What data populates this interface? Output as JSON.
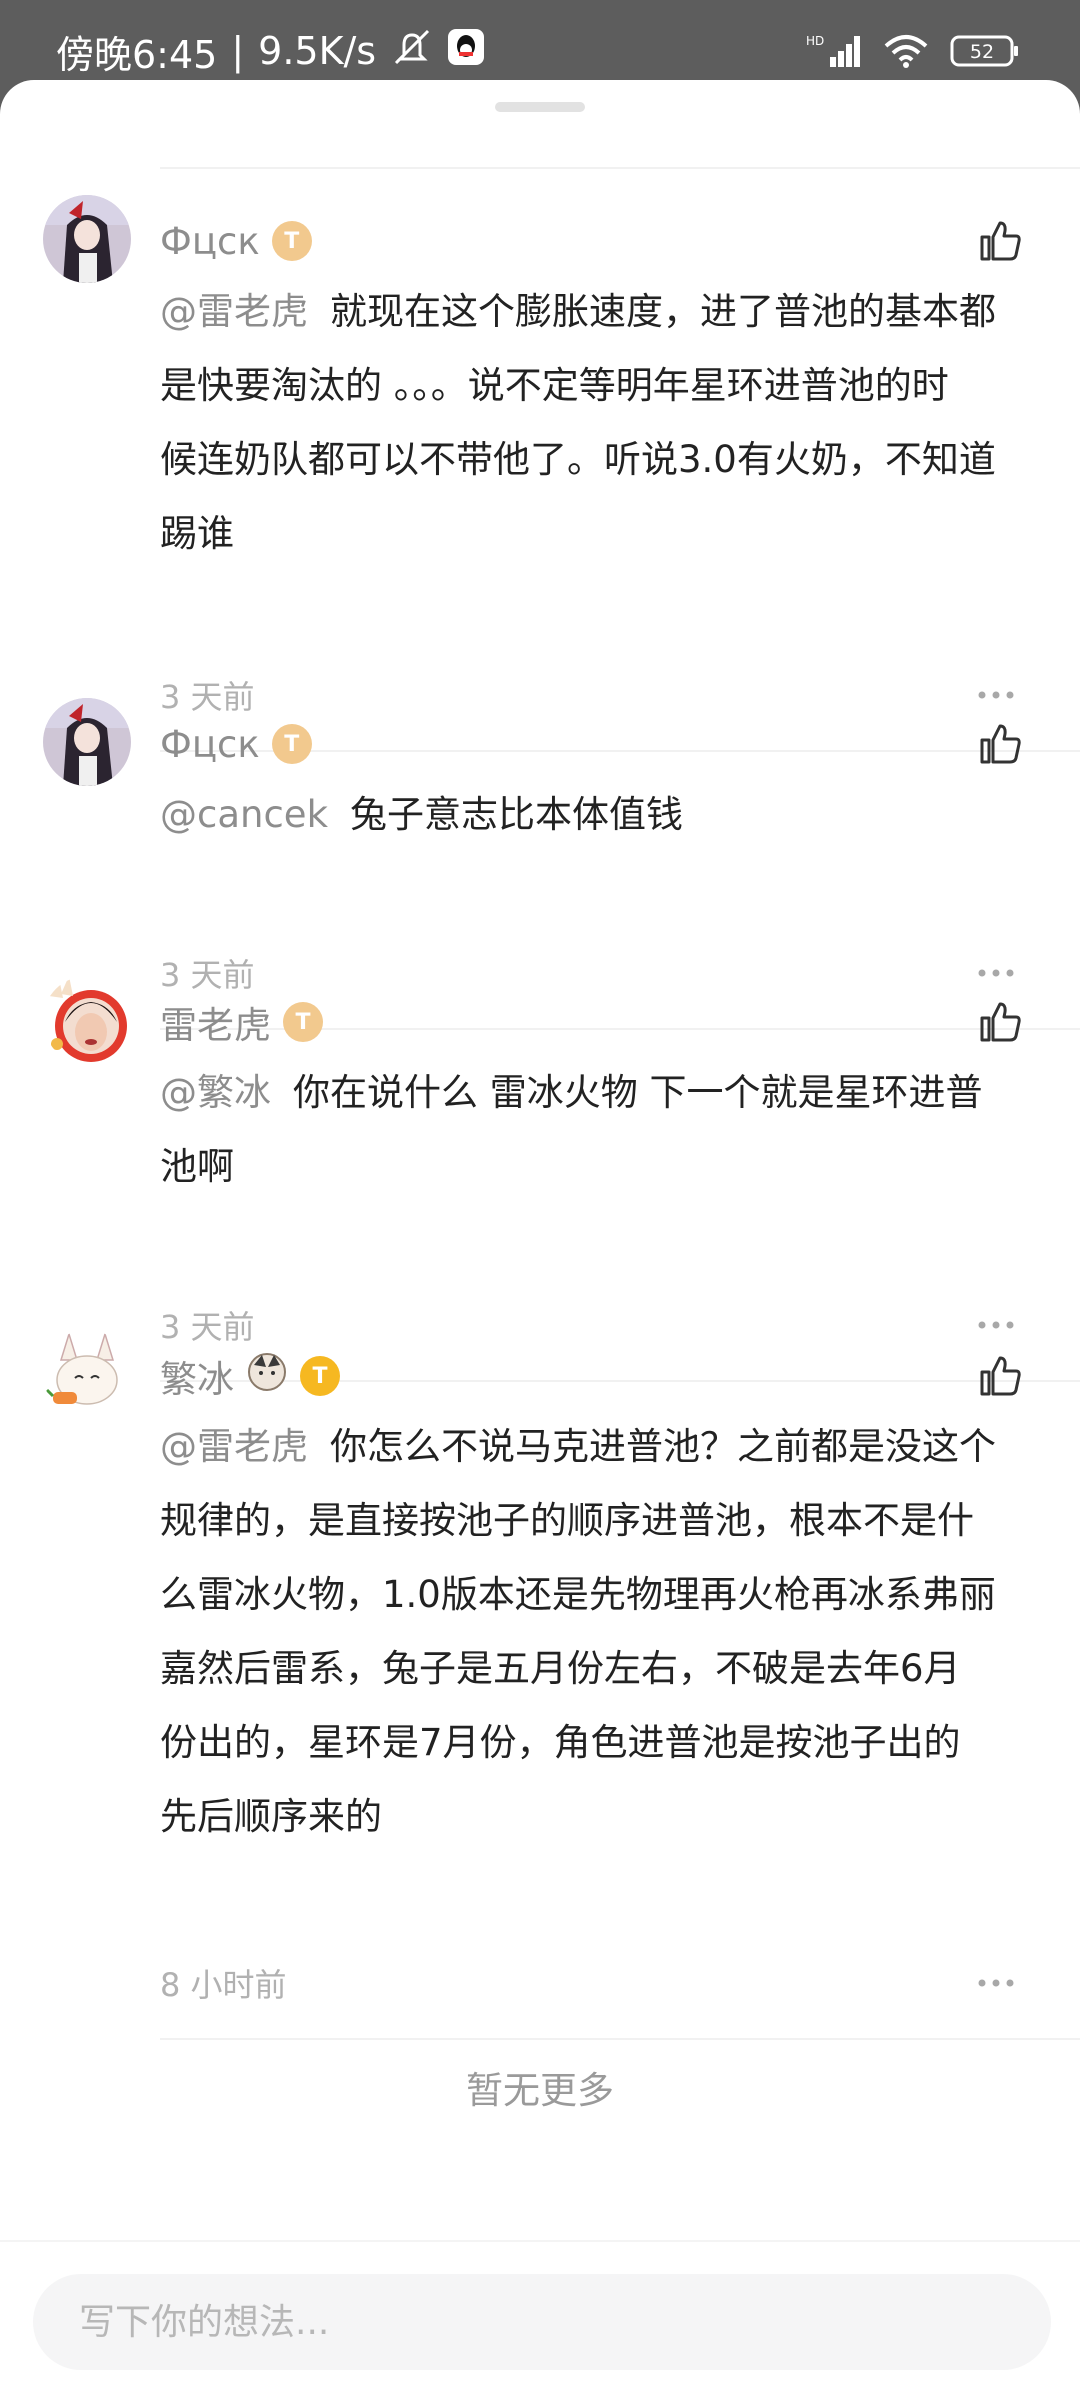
{
  "status_bar": {
    "time": "傍晚6:45",
    "separator": "|",
    "net_speed": "9.5K/s",
    "network_label": "HD",
    "battery": "52"
  },
  "comments": [
    {
      "username": "Фцск",
      "badge": "T",
      "mention": "@雷老虎",
      "lines": [
        "就现在这个膨胀速度，进了普池的基本都",
        "是快要淘汰的 。。。说不定等明年星环进普池的时",
        "候连奶队都可以不带他了。听说3.0有火奶，不知道",
        "踢谁"
      ],
      "time": "3 天前"
    },
    {
      "username": "Фцск",
      "badge": "T",
      "mention": "@cancek",
      "lines": [
        "兔子意志比本体值钱"
      ],
      "time": "3 天前"
    },
    {
      "username": "雷老虎",
      "badge": "T",
      "mention": "@繁冰",
      "lines": [
        "你在说什么  雷冰火物  下一个就是星环进普",
        "池啊"
      ],
      "time": "3 天前"
    },
    {
      "username": "繁冰",
      "badge": "T",
      "mention": "@雷老虎",
      "lines": [
        "你怎么不说马克进普池？之前都是没这个",
        "规律的，是直接按池子的顺序进普池，根本不是什",
        "么雷冰火物，1.0版本还是先物理再火枪再冰系弗丽",
        "嘉然后雷系，兔子是五月份左右，不破是去年6月",
        "份出的，星环是7月份，角色进普池是按池子出的",
        "先后顺序来的"
      ],
      "time": "8 小时前"
    }
  ],
  "footer": {
    "no_more": "暂无更多"
  },
  "input": {
    "placeholder": "写下你的想法..."
  }
}
